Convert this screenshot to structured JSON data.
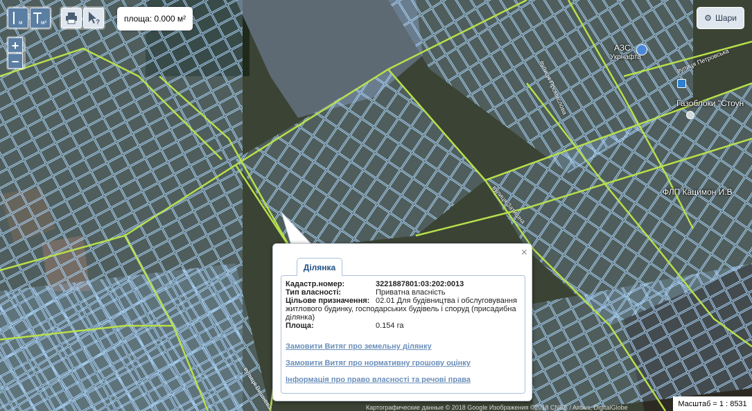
{
  "toolbar": {
    "measure_line_label": "м",
    "measure_area_label": "м²",
    "print_icon": "printer-icon",
    "identify_icon": "cursor-question-icon"
  },
  "zoom": {
    "in": "+",
    "out": "−"
  },
  "area_readout": "площа: 0.000 м²",
  "layers_button": {
    "label": "Шари",
    "icon": "gear-icon"
  },
  "map_labels": {
    "azs": "АЗС",
    "ukrnafta": "Укрнафта",
    "street_top_right": "вулиця Петровська",
    "gazobloky": "Газоблоки \"Стоун",
    "flp": "ФЛП Кацимон И.В",
    "street_promyslova": "вулиця Промислова",
    "street_zatyshna": "вулиця Затишна",
    "street_bottom_left": "вулиця Вишнева"
  },
  "popup": {
    "tab": "Ділянка",
    "close": "×",
    "fields": [
      {
        "key": "Кадастр.номер:",
        "value": "3221887801:03:202:0013",
        "bold": true
      },
      {
        "key": "Тип власності:",
        "value": "Приватна власність"
      }
    ],
    "purpose_key": "Цільове призначення:",
    "purpose_value": "02.01 Для будівництва і обслуговування житлового будинку, господарських будівель і споруд (присадибна ділянка)",
    "area_key": "Площа:",
    "area_value": "0.154 га",
    "links": [
      "Замовити Витяг про земельну ділянку",
      "Замовити Витяг про нормативну грошову оцінку",
      "Інформація про право власності та речові права"
    ]
  },
  "credits": "Картографические данные © 2018 Google Изображения ©2018 CNES / Airbus, DigitalGlobe",
  "scale": "Масштаб = 1 : 8531"
}
